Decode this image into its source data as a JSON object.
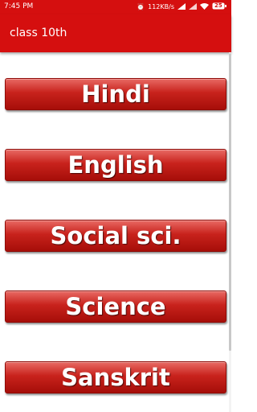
{
  "status_bar": {
    "time": "7:45 PM",
    "network_speed": "112KB/s",
    "battery": "25",
    "icons": [
      "alarm-icon",
      "signal-icon",
      "signal-icon",
      "wifi-icon",
      "battery-icon"
    ]
  },
  "app_bar": {
    "title": "class 10th"
  },
  "subjects": [
    "Hindi",
    "English",
    "Social sci.",
    "Science",
    "Sanskrit"
  ],
  "colors": {
    "primary": "#d50f0f",
    "button_top": "#e86a64",
    "button_bottom": "#a60e09"
  }
}
